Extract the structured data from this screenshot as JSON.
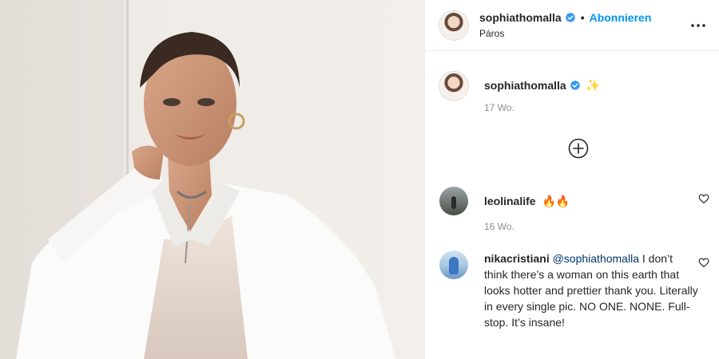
{
  "post": {
    "author": "sophiathomalla",
    "location": "Páros",
    "follow_label": "Abonnieren",
    "dot": "•",
    "caption_emoji": "✨",
    "caption_time": "17 Wo."
  },
  "comments": [
    {
      "user": "leolinalife",
      "text": "🔥🔥",
      "time": "16 Wo."
    },
    {
      "user": "nikacristiani",
      "mention": "@sophiathomalla",
      "text": " I don’t think there’s a woman on this earth that looks hotter and prettier thank you. Literally in every single pic. NO ONE. NONE. Full-stop. It’s insane!"
    }
  ],
  "icons": {
    "verified": "verified-badge-icon",
    "more": "more-options-icon",
    "load_more": "add-circle-icon",
    "like": "heart-icon"
  },
  "colors": {
    "accent": "#0095f6",
    "verified": "#3897f0",
    "muted": "#8e8e8e"
  }
}
